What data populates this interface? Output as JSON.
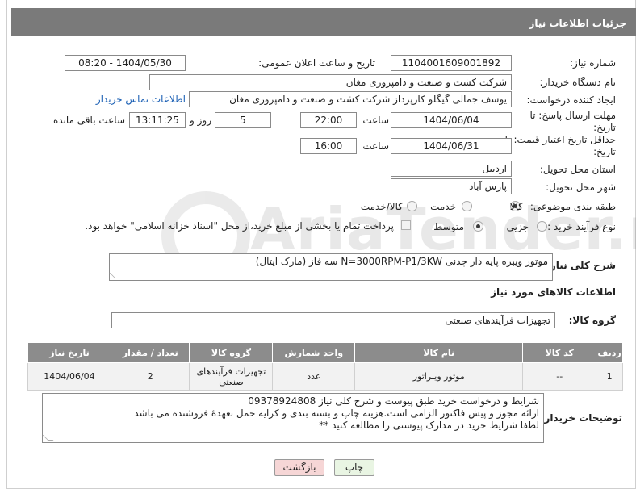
{
  "page": {
    "title": "جزئیات اطلاعات نیاز"
  },
  "fields": {
    "need_number_label": "شماره نیاز:",
    "need_number": "1104001609001892",
    "announce_label": "تاریخ و ساعت اعلان عمومی:",
    "announce_value": "1404/05/30 - 08:20",
    "buyer_org_label": "نام دستگاه خریدار:",
    "buyer_org": "شرکت کشت و صنعت و دامپروری مغان",
    "creator_label": "ایجاد کننده درخواست:",
    "creator": "یوسف جمالی گیگلو کارپرداز شرکت کشت و صنعت و دامپروری مغان",
    "contact_link": "اطلاعات تماس خریدار",
    "reply_deadline_label": "مهلت ارسال پاسخ: تا تاریخ:",
    "reply_date": "1404/06/04",
    "time_label": "ساعت",
    "reply_time": "22:00",
    "days_value": "5",
    "days_label": "روز و",
    "remaining_time": "13:11:25",
    "remaining_label": "ساعت باقی مانده",
    "price_deadline_label": "حداقل تاریخ اعتبار قیمت: تا تاریخ:",
    "price_date": "1404/06/31",
    "price_time": "16:00",
    "province_label": "استان محل تحویل:",
    "province": "اردبیل",
    "city_label": "شهر محل تحویل:",
    "city": "پارس آباد",
    "category_label": "طبقه بندی موضوعی:",
    "category_options": [
      "کالا",
      "خدمت",
      "کالا/خدمت"
    ],
    "category_selected": "کالا",
    "process_label": "نوع فرآیند خرید :",
    "process_options": [
      "جزیی",
      "متوسط"
    ],
    "process_selected": "متوسط",
    "payment_note": "پرداخت تمام یا بخشی از مبلغ خرید،از محل \"اسناد خزانه اسلامی\" خواهد بود.",
    "description_label": "شرح کلی نیاز:",
    "description": "موتور ویبره پایه دار چدنی  N=3000RPM-P1/3KW  سه فاز (مارک ایتال)"
  },
  "goods": {
    "section_title": "اطلاعات کالاهای مورد نیاز",
    "group_label": "گروه کالا:",
    "group_value": "تجهیزات فرآیندهای صنعتی",
    "columns": [
      "ردیف",
      "کد کالا",
      "نام کالا",
      "واحد شمارش",
      "گروه کالا",
      "تعداد / مقدار",
      "تاریخ نیاز"
    ],
    "rows": [
      {
        "row": "1",
        "code": "--",
        "name": "موتور ویبراتور",
        "unit": "عدد",
        "group": "تجهیزات فرآیندهای صنعتی",
        "qty": "2",
        "date": "1404/06/04"
      }
    ]
  },
  "buyer_notes": {
    "label": "توضیحات خریدار:",
    "lines": [
      "شرایط و درخواست خرید طبق پیوست و شرح کلی نیاز 09378924808",
      "ارائه مجوز و پیش فاکتور الزامی است.هزینه چاپ و بسته بندی و کرایه حمل بعهدهٔ فروشنده می باشد",
      "لطفا شرایط خرید در مدارک پیوستی را مطالعه کنید **"
    ]
  },
  "buttons": {
    "print": "چاپ",
    "back": "بازگشت"
  },
  "watermark": {
    "text": "AriaTender.neT"
  },
  "colors": {
    "header_bg": "#7a7a7a",
    "table_header_bg": "#8c8c8c",
    "back_button_bg": "#f6d6d6",
    "print_button_bg": "#e9f5e3",
    "link": "#1a5fb4"
  }
}
